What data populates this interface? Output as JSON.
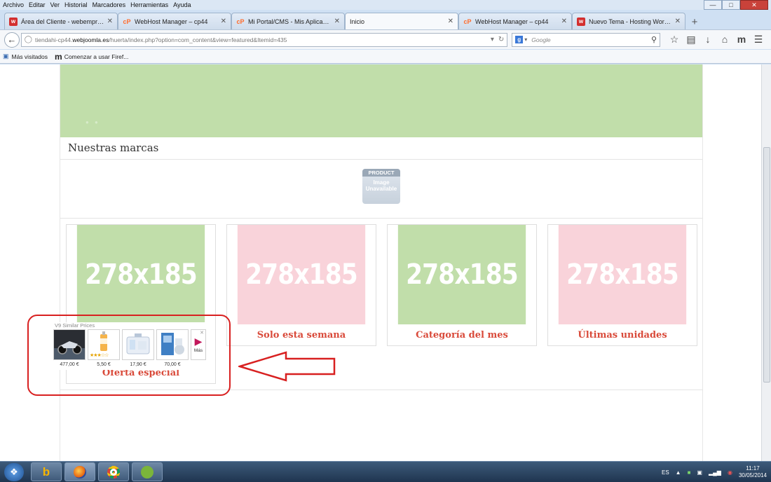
{
  "menubar": {
    "items": [
      "Archivo",
      "Editar",
      "Ver",
      "Historial",
      "Marcadores",
      "Herramientas",
      "Ayuda"
    ]
  },
  "tabs": [
    {
      "title": "Área del Cliente - webempresa.co...",
      "favicon": "w"
    },
    {
      "title": "WebHost Manager – cp44",
      "favicon": "cP"
    },
    {
      "title": "Mi Portal/CMS - Mis Aplicaciones...",
      "favicon": "cP"
    },
    {
      "title": "Inicio",
      "favicon": ""
    },
    {
      "title": "WebHost Manager – cp44",
      "favicon": "cP"
    },
    {
      "title": "Nuevo Tema - Hosting WordPres...",
      "favicon": "w"
    }
  ],
  "nav": {
    "url_pre": "tiendahi-cp44.",
    "url_domain": "webjoomla.es",
    "url_post": "/huerta/index.php?option=com_content&view=featured&Itemid=435",
    "search_placeholder": "Google"
  },
  "bookmarks": {
    "items": [
      "Más visitados",
      "Comenzar a usar Firef..."
    ]
  },
  "page": {
    "brands_title": "Nuestras marcas",
    "product_image": {
      "line1": "PRODUCT",
      "line2": "Image",
      "line3": "Unavailable"
    },
    "cards": [
      {
        "placeholder": "278x185",
        "caption": "Oferta especial",
        "color": "#c1deaa"
      },
      {
        "placeholder": "278x185",
        "caption": "Solo esta semana",
        "color": "#f9d3da"
      },
      {
        "placeholder": "278x185",
        "caption": "Categoría del mes",
        "color": "#c1deaa"
      },
      {
        "placeholder": "278x185",
        "caption": "Últimas unidades",
        "color": "#f9d3da"
      }
    ],
    "similar_prices": {
      "title": "V9 Similar Prices",
      "items": [
        {
          "price": "477,00 €",
          "rating": ""
        },
        {
          "price": "5,50 €",
          "rating": "★★★☆☆"
        },
        {
          "price": "17,90 €",
          "rating": ""
        },
        {
          "price": "70,00 €",
          "rating": ""
        }
      ],
      "more_label": "Más"
    }
  },
  "colors": {
    "accent_red": "#d94a3a",
    "annotation_red": "#d82020",
    "banner_green": "#c1deaa",
    "card_pink": "#f9d3da"
  },
  "taskbar": {
    "apps": [
      "bing",
      "firefox",
      "chrome",
      "spotify"
    ],
    "lang": "ES",
    "time": "11:17",
    "date": "30/05/2014"
  }
}
